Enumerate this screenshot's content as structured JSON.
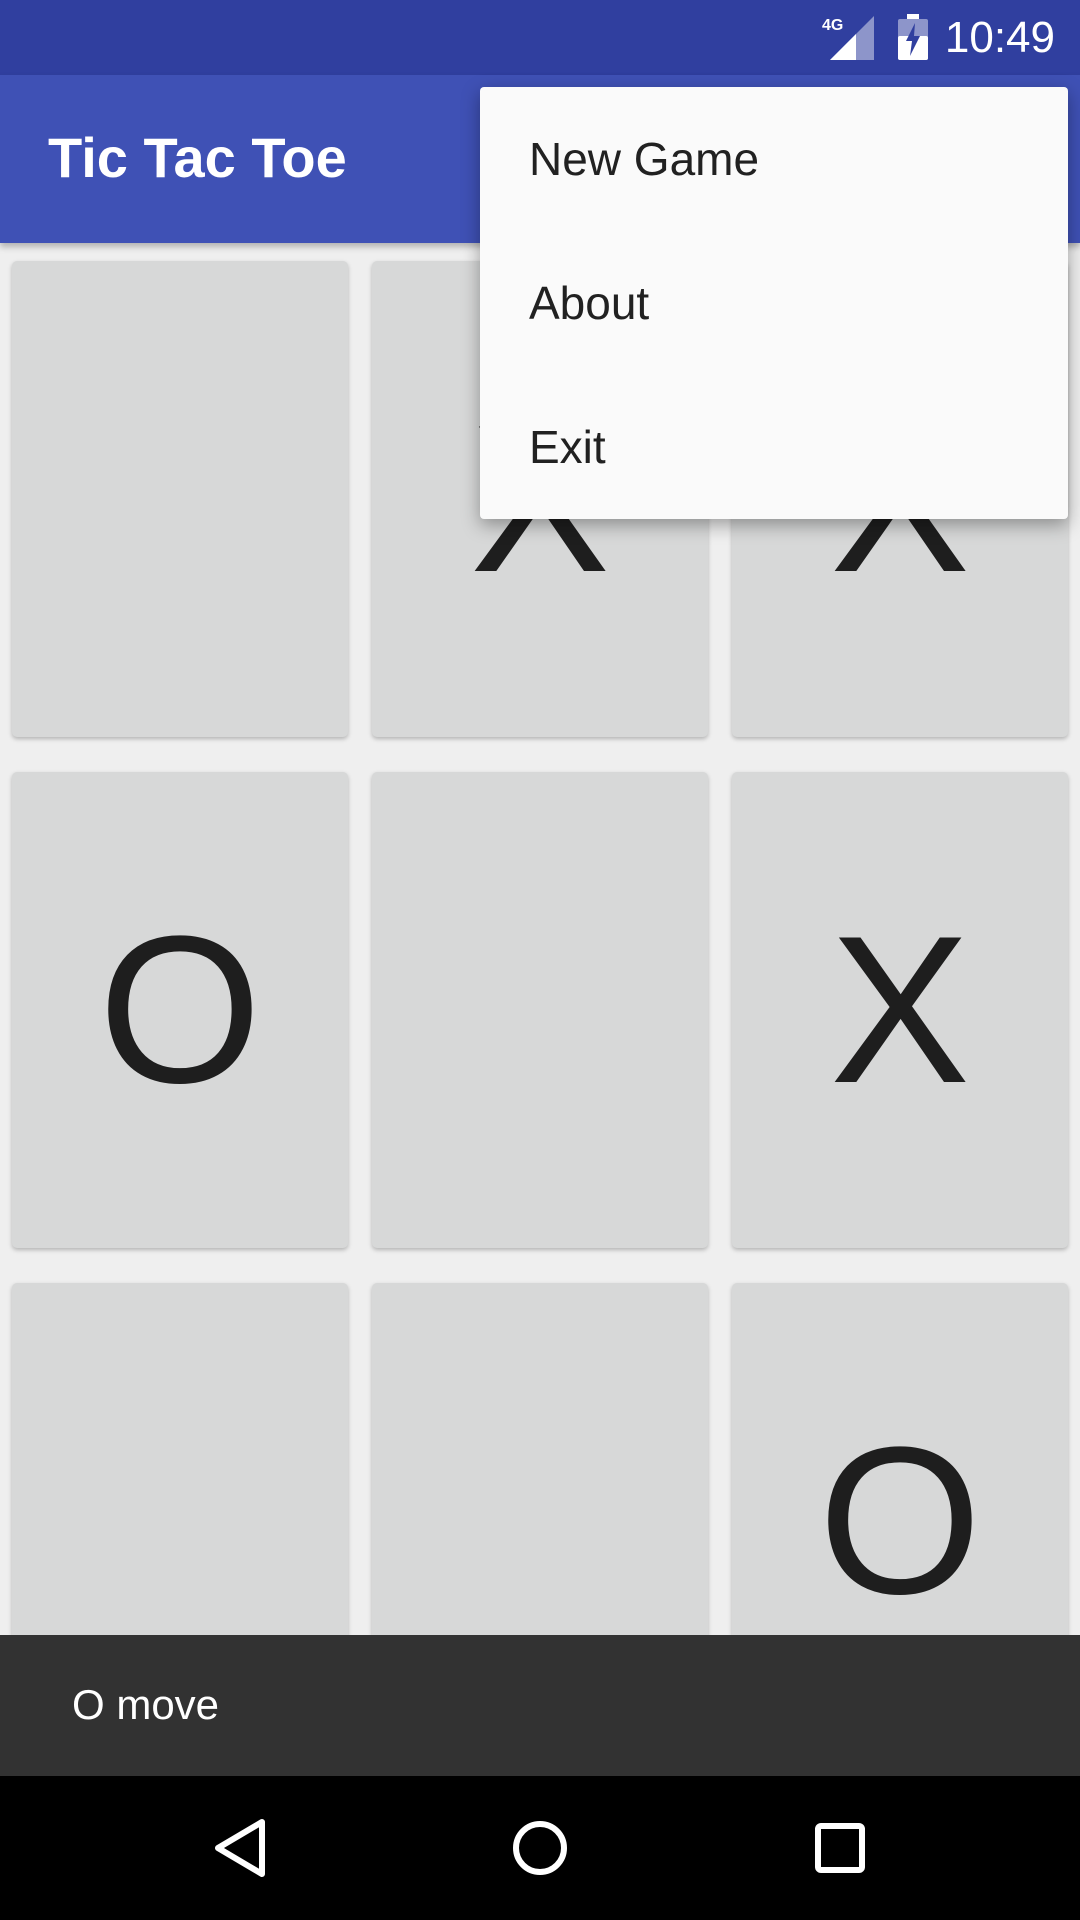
{
  "status_bar": {
    "network": "4G",
    "time": "10:49"
  },
  "app_bar": {
    "title": "Tic Tac Toe"
  },
  "board": {
    "cells": [
      {
        "mark": ""
      },
      {
        "mark": "X"
      },
      {
        "mark": "X"
      },
      {
        "mark": "O"
      },
      {
        "mark": ""
      },
      {
        "mark": "X"
      },
      {
        "mark": ""
      },
      {
        "mark": ""
      },
      {
        "mark": "O"
      }
    ]
  },
  "overflow_menu": {
    "items": [
      {
        "label": "New Game"
      },
      {
        "label": "About"
      },
      {
        "label": "Exit"
      }
    ]
  },
  "snackbar": {
    "message": "O move"
  },
  "nav_bar": {
    "icons": [
      "back-icon",
      "home-icon",
      "recents-icon"
    ]
  },
  "colors": {
    "status_bar": "#303f9f",
    "app_bar": "#3f51b5",
    "cell": "#d7d8d8",
    "snackbar": "#323232"
  }
}
